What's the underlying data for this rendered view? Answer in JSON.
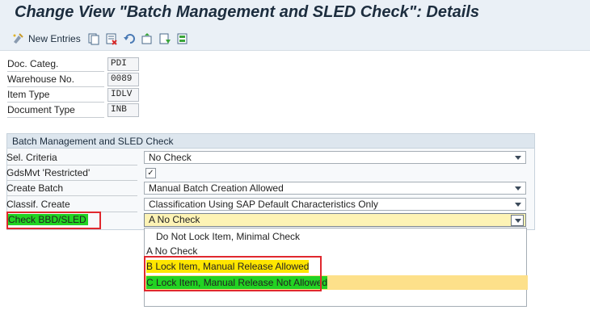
{
  "title": "Change View \"Batch Management and SLED Check\": Details",
  "toolbar": {
    "new_entries_label": "New Entries",
    "icons": [
      "new-entries-icon",
      "copy-icon",
      "delete-icon",
      "undo-icon",
      "select-icon",
      "select-all-icon",
      "deselect-icon"
    ]
  },
  "header_fields": [
    {
      "label": "Doc. Categ.",
      "value": "PDI"
    },
    {
      "label": "Warehouse No.",
      "value": "0089"
    },
    {
      "label": "Item Type",
      "value": "IDLV"
    },
    {
      "label": "Document Type",
      "value": "INB"
    }
  ],
  "group": {
    "title": "Batch Management and SLED Check",
    "rows": [
      {
        "label": "Sel. Criteria",
        "value": "No Check"
      },
      {
        "label": "GdsMvt 'Restricted'",
        "checked": "✓"
      },
      {
        "label": "Create Batch",
        "value": "Manual Batch Creation Allowed"
      },
      {
        "label": "Classif. Create",
        "value": "Classification Using SAP Default Characteristics Only"
      },
      {
        "label": "Check BBD/SLED",
        "value": "A No Check"
      }
    ]
  },
  "dropdown": {
    "options": [
      "Do Not Lock Item, Minimal Check",
      "A No Check",
      "B Lock Item, Manual Release Allowed",
      "C Lock Item, Manual Release Not Allowed"
    ]
  },
  "colors": {
    "highlight_green": "#22d322",
    "highlight_yellow": "#ffe600",
    "selected_row": "#fde08a",
    "annotation_red": "#e0282e"
  }
}
